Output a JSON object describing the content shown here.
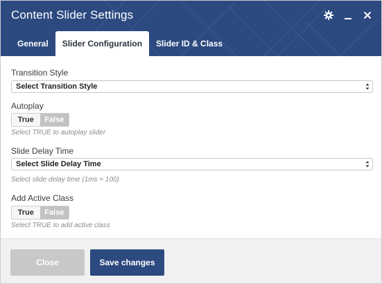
{
  "window": {
    "title": "Content Slider Settings",
    "colors": {
      "header": "#2c4a80",
      "accent": "#2c4a80",
      "toggle_off": "#c2c2c2"
    },
    "icons": [
      "gear-icon",
      "minimize-icon",
      "close-icon"
    ]
  },
  "tabs": [
    {
      "label": "General",
      "active": false
    },
    {
      "label": "Slider Configuration",
      "active": true
    },
    {
      "label": "Slider ID & Class",
      "active": false
    }
  ],
  "form": {
    "transition_style": {
      "label": "Transition Style",
      "selected": "Select Transition Style"
    },
    "autoplay": {
      "label": "Autoplay",
      "options": [
        "True",
        "False"
      ],
      "selected": "False",
      "help": "Select TRUE to autoplay slider"
    },
    "slide_delay": {
      "label": "Slide Delay Time",
      "selected": "Select Slide Delay Time",
      "help": "Select slide delay time (1ms = 100)"
    },
    "active_class": {
      "label": "Add Active Class",
      "options": [
        "True",
        "False"
      ],
      "selected": "False",
      "help": "Select TRUE to add active class"
    }
  },
  "footer": {
    "close_label": "Close",
    "save_label": "Save changes"
  }
}
